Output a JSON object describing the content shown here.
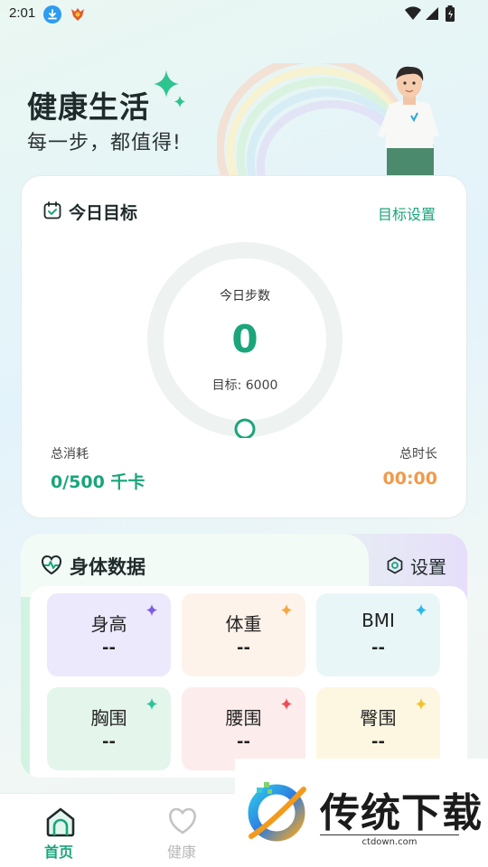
{
  "status_bar": {
    "time": "2:01"
  },
  "hero": {
    "title": "健康生活",
    "subtitle": "每一步，都值得!"
  },
  "goal_card": {
    "title": "今日目标",
    "settings_link": "目标设置",
    "steps_label": "今日步数",
    "steps_value": "0",
    "steps_target": "目标: 6000",
    "progress": 0,
    "calories_label": "总消耗",
    "calories_value": "0/500 千卡",
    "duration_label": "总时长",
    "duration_value": "00:00"
  },
  "body_card": {
    "title": "身体数据",
    "settings_label": "设置",
    "metrics": [
      {
        "label": "身高",
        "value": "--",
        "bg": "#ebe9fb",
        "spark": "#7c5ce6"
      },
      {
        "label": "体重",
        "value": "--",
        "bg": "#fdf3ea",
        "spark": "#f5a742"
      },
      {
        "label": "BMI",
        "value": "--",
        "bg": "#e9f6f8",
        "spark": "#2bb8e8"
      },
      {
        "label": "胸围",
        "value": "--",
        "bg": "#e4f5ec",
        "spark": "#2cc59a"
      },
      {
        "label": "腰围",
        "value": "--",
        "bg": "#fdecec",
        "spark": "#ef4b57"
      },
      {
        "label": "臀围",
        "value": "--",
        "bg": "#fdf7e1",
        "spark": "#f2c330"
      }
    ]
  },
  "bottom_nav": {
    "items": [
      {
        "label": "首页",
        "active": true
      },
      {
        "label": "健康",
        "active": false
      }
    ]
  },
  "watermark": {
    "brand": "传统下载",
    "url": "ctdown.com"
  },
  "colors": {
    "accent": "#1aa57a",
    "duration": "#f2994a"
  }
}
